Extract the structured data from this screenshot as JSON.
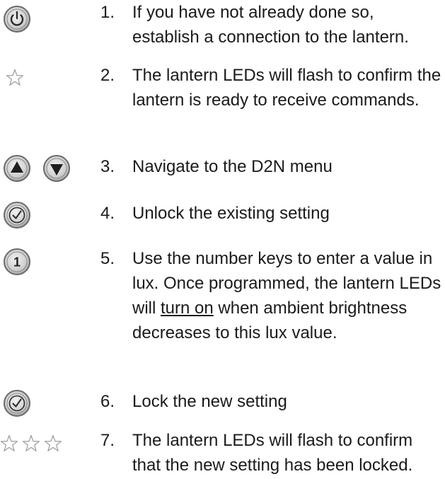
{
  "steps": [
    {
      "number": "1.",
      "icon": "power-button-icon",
      "text": "If you have not already done so, establish a connection to the lantern."
    },
    {
      "number": "2.",
      "icon": "single-star-icon",
      "text": "The lantern LEDs will flash to confirm the lantern is ready to receive commands."
    },
    {
      "number": "3.",
      "icon": "up-down-arrow-buttons-icon",
      "text": "Navigate to the D2N menu"
    },
    {
      "number": "4.",
      "icon": "checkmark-button-icon",
      "text": "Unlock the existing setting"
    },
    {
      "number": "5.",
      "icon": "number-one-button-icon",
      "text_before": "Use the number keys to enter a value in lux. Once programmed, the lantern LEDs will ",
      "text_underlined": "turn on",
      "text_after": " when ambient brightness decreases to this lux value."
    },
    {
      "number": "6.",
      "icon": "checkmark-button-icon",
      "text": "Lock the new setting"
    },
    {
      "number": "7.",
      "icon": "three-stars-icon",
      "text": "The lantern LEDs will flash to confirm that the new setting has been locked."
    }
  ],
  "icon_labels": {
    "number_key": "1"
  },
  "colors": {
    "button_fill": "#d4d4d4",
    "button_ring": "#6a6a6a",
    "glyph": "#2b2b2b",
    "star_outline": "#9a9a9a"
  }
}
